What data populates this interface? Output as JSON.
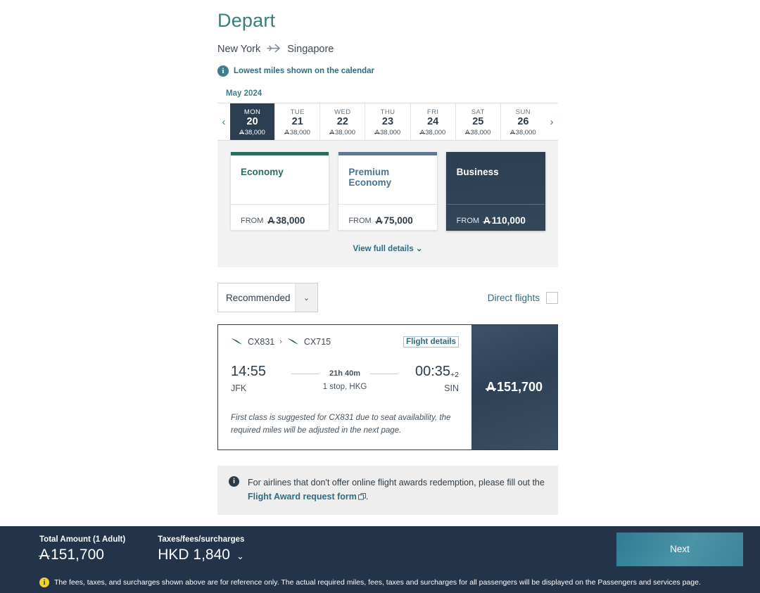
{
  "header": {
    "title": "Depart",
    "origin": "New York",
    "destination": "Singapore",
    "plane_icon": "plane-icon",
    "info_icon": "i",
    "lowest_miles_note": "Lowest miles shown on the calendar"
  },
  "calendar": {
    "month": "May 2024",
    "prev_icon": "‹",
    "next_icon": "›",
    "miles_symbol": "A",
    "days": [
      {
        "dow": "MON",
        "date": "20",
        "miles": "38,000",
        "selected": true
      },
      {
        "dow": "TUE",
        "date": "21",
        "miles": "38,000",
        "selected": false
      },
      {
        "dow": "WED",
        "date": "22",
        "miles": "38,000",
        "selected": false
      },
      {
        "dow": "THU",
        "date": "23",
        "miles": "38,000",
        "selected": false
      },
      {
        "dow": "FRI",
        "date": "24",
        "miles": "38,000",
        "selected": false
      },
      {
        "dow": "SAT",
        "date": "25",
        "miles": "38,000",
        "selected": false
      },
      {
        "dow": "SUN",
        "date": "26",
        "miles": "38,000",
        "selected": false
      }
    ]
  },
  "cabins": {
    "from_label": "FROM",
    "items": [
      {
        "name": "Economy",
        "miles": "38,000",
        "accent": "#2c6b5f",
        "selected": false
      },
      {
        "name": "Premium Economy",
        "miles": "75,000",
        "accent": "#61798e",
        "selected": false
      },
      {
        "name": "Business",
        "miles": "110,000",
        "accent": "#2b3e52",
        "selected": true
      }
    ],
    "view_full_details": "View full details",
    "view_full_caret": "⌄"
  },
  "filters": {
    "sort_value": "Recommended",
    "sort_caret": "⌄",
    "direct_flights_label": "Direct flights",
    "direct_flights_checked": false
  },
  "flight": {
    "segments": [
      "CX831",
      "CX715"
    ],
    "segment_separator": "›",
    "flight_details_label": "Flight details",
    "depart_time": "14:55",
    "depart_airport": "JFK",
    "duration": "21h 40m",
    "stops": "1 stop, HKG",
    "arrive_time": "00:35",
    "arrive_day_offset": "+2",
    "arrive_airport": "SIN",
    "note": "First class is suggested for CX831 due to seat availability, the required miles will be adjusted in the next page.",
    "price_symbol": "A",
    "price": "151,700"
  },
  "notice": {
    "icon": "i",
    "text_before": "For airlines that don't offer online flight awards redemption, please fill out the",
    "link_text": "Flight Award request form",
    "text_after": "."
  },
  "footer": {
    "total_label": "Total Amount (1 Adult)",
    "total_symbol": "A",
    "total_value": "151,700",
    "taxes_label": "Taxes/fees/surcharges",
    "taxes_value": "HKD 1,840",
    "taxes_caret": "⌄",
    "next_label": "Next",
    "warn_icon": "i",
    "disclaimer": "The fees, taxes, and surcharges shown above are for reference only. The actual required miles, fees, taxes and surcharges for all passengers will be displayed on the Passengers and services page."
  },
  "colors": {
    "brand_teal": "#367f7a",
    "link_blue": "#2e6d80",
    "navy": "#2b3e52",
    "footer_navy": "#22334a",
    "next_button": "#3c8499",
    "warn_yellow": "#f5d033"
  }
}
